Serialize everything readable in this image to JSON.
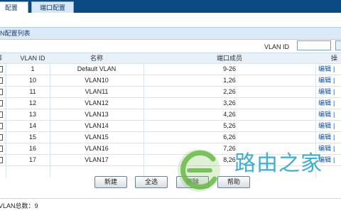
{
  "tabs": [
    {
      "label": "配置",
      "active": true
    },
    {
      "label": "端口配置",
      "active": false
    }
  ],
  "section_title": "N配置列表",
  "filter": {
    "label": "VLAN ID",
    "value": ""
  },
  "table": {
    "headers": {
      "select": "择",
      "vlan_id": "VLAN ID",
      "name": "名称",
      "ports": "端口成员",
      "ops": "操"
    },
    "rows": [
      {
        "id": "1",
        "name": "Default VLAN",
        "ports": "9-26",
        "edit": "编辑",
        "sep": "|"
      },
      {
        "id": "10",
        "name": "VLAN10",
        "ports": "1,26",
        "edit": "编辑",
        "sep": "|"
      },
      {
        "id": "11",
        "name": "VLAN11",
        "ports": "2,26",
        "edit": "编辑",
        "sep": "|"
      },
      {
        "id": "12",
        "name": "VLAN12",
        "ports": "3,26",
        "edit": "编辑",
        "sep": "|"
      },
      {
        "id": "13",
        "name": "VLAN13",
        "ports": "4,26",
        "edit": "编辑",
        "sep": "|"
      },
      {
        "id": "14",
        "name": "VLAN14",
        "ports": "5,26",
        "edit": "编辑",
        "sep": "|"
      },
      {
        "id": "15",
        "name": "VLAN15",
        "ports": "6,26",
        "edit": "编辑",
        "sep": "|"
      },
      {
        "id": "16",
        "name": "VLAN16",
        "ports": "7,26",
        "edit": "编辑",
        "sep": "|"
      },
      {
        "id": "17",
        "name": "VLAN17",
        "ports": "8,26",
        "edit": "编辑",
        "sep": "|"
      }
    ]
  },
  "buttons": {
    "new": "新建",
    "select_all": "全选",
    "delete": "删除",
    "help": "帮助"
  },
  "footer": {
    "total": "VLAN总数：9"
  },
  "watermark": {
    "text": "路由之家"
  },
  "colors": {
    "tab_bar": "#0b4a82",
    "header_bg": "#e8f0f8",
    "link": "#1050a0",
    "watermark": "#2ba5c9"
  }
}
